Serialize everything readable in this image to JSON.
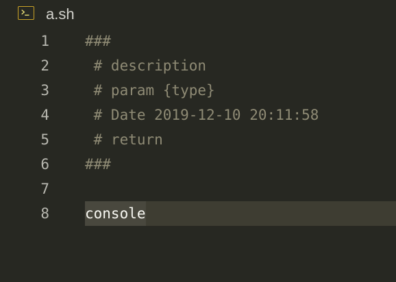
{
  "tab": {
    "icon": "terminal-icon",
    "file_name": "a.sh"
  },
  "editor": {
    "lines": [
      {
        "number": "1",
        "text": "###"
      },
      {
        "number": "2",
        "text": " # description"
      },
      {
        "number": "3",
        "text": " # param {type}"
      },
      {
        "number": "4",
        "text": " # Date 2019-12-10 20:11:58"
      },
      {
        "number": "5",
        "text": " # return"
      },
      {
        "number": "6",
        "text": "###"
      },
      {
        "number": "7",
        "text": ""
      },
      {
        "number": "8",
        "text": "console"
      }
    ]
  },
  "colors": {
    "background": "#272822",
    "comment": "#8f8b75",
    "text": "#f8f8f2",
    "current_line": "#3e3d32",
    "selection": "#49483e",
    "icon_accent": "#c9a227"
  }
}
